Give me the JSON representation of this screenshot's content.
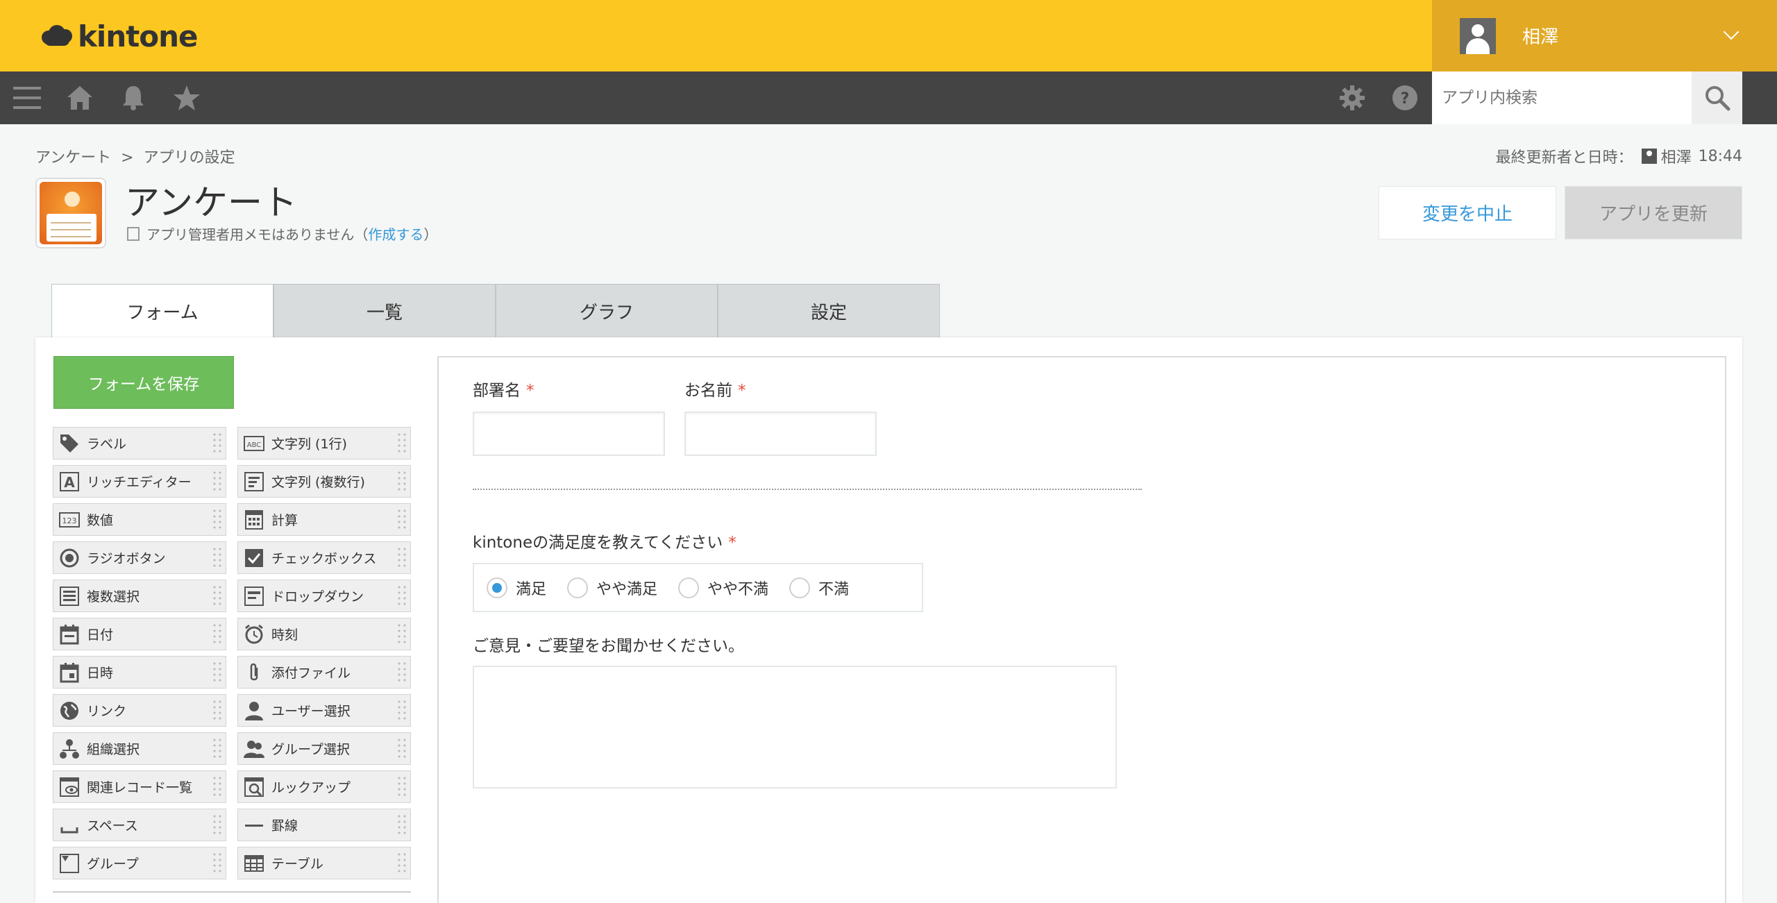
{
  "header": {
    "logo_text": "kintone",
    "user_name": "相澤",
    "brand_color": "#fcc720"
  },
  "navbar": {
    "search_placeholder": "アプリ内検索",
    "icons": [
      "menu-icon",
      "home-icon",
      "bell-icon",
      "star-icon",
      "gear-icon",
      "help-icon",
      "search-icon"
    ]
  },
  "breadcrumb": {
    "items": [
      "アンケート",
      "アプリの設定"
    ],
    "separator": ">"
  },
  "updated": {
    "label": "最終更新者と日時：",
    "user": "相澤",
    "time": "18:44"
  },
  "app": {
    "title": "アンケート",
    "memo_text": "アプリ管理者用メモはありません（",
    "memo_link": "作成する",
    "memo_close": "）"
  },
  "actions": {
    "cancel_label": "変更を中止",
    "update_label": "アプリを更新"
  },
  "tabs": [
    {
      "label": "フォーム",
      "active": true
    },
    {
      "label": "一覧",
      "active": false
    },
    {
      "label": "グラフ",
      "active": false
    },
    {
      "label": "設定",
      "active": false
    }
  ],
  "palette": {
    "save_label": "フォームを保存",
    "items": [
      {
        "label": "ラベル",
        "icon": "tag-icon"
      },
      {
        "label": "文字列 (1行)",
        "icon": "abc-icon"
      },
      {
        "label": "リッチエディター",
        "icon": "rich-editor-icon"
      },
      {
        "label": "文字列 (複数行)",
        "icon": "multiline-icon"
      },
      {
        "label": "数値",
        "icon": "number-icon"
      },
      {
        "label": "計算",
        "icon": "calculator-icon"
      },
      {
        "label": "ラジオボタン",
        "icon": "radio-icon"
      },
      {
        "label": "チェックボックス",
        "icon": "checkbox-icon"
      },
      {
        "label": "複数選択",
        "icon": "multi-select-icon"
      },
      {
        "label": "ドロップダウン",
        "icon": "dropdown-icon"
      },
      {
        "label": "日付",
        "icon": "date-icon"
      },
      {
        "label": "時刻",
        "icon": "clock-icon"
      },
      {
        "label": "日時",
        "icon": "datetime-icon"
      },
      {
        "label": "添付ファイル",
        "icon": "paperclip-icon"
      },
      {
        "label": "リンク",
        "icon": "globe-icon"
      },
      {
        "label": "ユーザー選択",
        "icon": "user-icon"
      },
      {
        "label": "組織選択",
        "icon": "org-icon"
      },
      {
        "label": "グループ選択",
        "icon": "group-icon"
      },
      {
        "label": "関連レコード一覧",
        "icon": "related-records-icon"
      },
      {
        "label": "ルックアップ",
        "icon": "lookup-icon"
      },
      {
        "label": "スペース",
        "icon": "space-icon"
      },
      {
        "label": "罫線",
        "icon": "rule-icon"
      },
      {
        "label": "グループ",
        "icon": "group-field-icon"
      },
      {
        "label": "テーブル",
        "icon": "table-icon"
      }
    ]
  },
  "form": {
    "dept_label": "部署名",
    "name_label": "お名前",
    "required_mark": "*",
    "satisfaction_label": "kintoneの満足度を教えてください",
    "satisfaction_options": [
      "満足",
      "やや満足",
      "やや不満",
      "不満"
    ],
    "satisfaction_selected": "満足",
    "comment_label": "ご意見・ご要望をお聞かせください。"
  }
}
